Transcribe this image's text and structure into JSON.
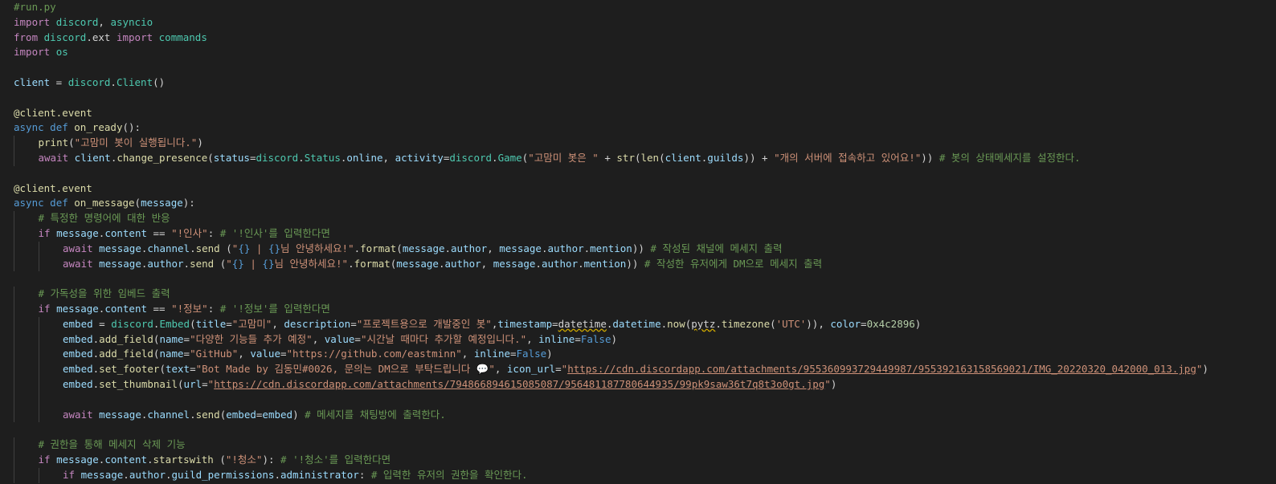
{
  "editor": {
    "lines": [
      {
        "indent": 0,
        "tokens": [
          [
            "com",
            "#run.py"
          ]
        ]
      },
      {
        "indent": 0,
        "tokens": [
          [
            "ctl",
            "import"
          ],
          [
            "p",
            " "
          ],
          [
            "cls",
            "discord"
          ],
          [
            "p",
            ", "
          ],
          [
            "cls",
            "asyncio"
          ]
        ]
      },
      {
        "indent": 0,
        "tokens": [
          [
            "ctl",
            "from"
          ],
          [
            "p",
            " "
          ],
          [
            "cls",
            "discord"
          ],
          [
            "p",
            ".ext "
          ],
          [
            "ctl",
            "import"
          ],
          [
            "p",
            " "
          ],
          [
            "cls",
            "commands"
          ]
        ]
      },
      {
        "indent": 0,
        "tokens": [
          [
            "ctl",
            "import"
          ],
          [
            "p",
            " "
          ],
          [
            "cls",
            "os"
          ]
        ]
      },
      {
        "indent": 0,
        "tokens": []
      },
      {
        "indent": 0,
        "tokens": [
          [
            "var",
            "client"
          ],
          [
            "p",
            " = "
          ],
          [
            "cls",
            "discord"
          ],
          [
            "p",
            "."
          ],
          [
            "cls",
            "Client"
          ],
          [
            "p",
            "()"
          ]
        ]
      },
      {
        "indent": 0,
        "tokens": []
      },
      {
        "indent": 0,
        "tokens": [
          [
            "dec",
            "@client.event"
          ]
        ]
      },
      {
        "indent": 0,
        "tokens": [
          [
            "kw",
            "async"
          ],
          [
            "p",
            " "
          ],
          [
            "kw",
            "def"
          ],
          [
            "p",
            " "
          ],
          [
            "fn",
            "on_ready"
          ],
          [
            "p",
            "():"
          ]
        ]
      },
      {
        "indent": 1,
        "tokens": [
          [
            "fn",
            "print"
          ],
          [
            "p",
            "("
          ],
          [
            "str",
            "\"고맘미 봇이 실행됩니다.\""
          ],
          [
            "p",
            ")"
          ]
        ]
      },
      {
        "indent": 1,
        "tokens": [
          [
            "ctl",
            "await"
          ],
          [
            "p",
            " "
          ],
          [
            "var",
            "client"
          ],
          [
            "p",
            "."
          ],
          [
            "fn",
            "change_presence"
          ],
          [
            "p",
            "("
          ],
          [
            "var",
            "status"
          ],
          [
            "p",
            "="
          ],
          [
            "cls",
            "discord"
          ],
          [
            "p",
            "."
          ],
          [
            "cls",
            "Status"
          ],
          [
            "p",
            "."
          ],
          [
            "var",
            "online"
          ],
          [
            "p",
            ", "
          ],
          [
            "var",
            "activity"
          ],
          [
            "p",
            "="
          ],
          [
            "cls",
            "discord"
          ],
          [
            "p",
            "."
          ],
          [
            "cls",
            "Game"
          ],
          [
            "p",
            "("
          ],
          [
            "str",
            "\"고맘미 봇은 \""
          ],
          [
            "p",
            " + "
          ],
          [
            "fn",
            "str"
          ],
          [
            "p",
            "("
          ],
          [
            "fn",
            "len"
          ],
          [
            "p",
            "("
          ],
          [
            "var",
            "client"
          ],
          [
            "p",
            "."
          ],
          [
            "var",
            "guilds"
          ],
          [
            "p",
            ")) + "
          ],
          [
            "str",
            "\"개의 서버에 접속하고 있어요!\""
          ],
          [
            "p",
            "))"
          ],
          [
            "com",
            " # 봇의 상태메세지를 설정한다."
          ]
        ]
      },
      {
        "indent": 0,
        "tokens": []
      },
      {
        "indent": 0,
        "tokens": [
          [
            "dec",
            "@client.event"
          ]
        ]
      },
      {
        "indent": 0,
        "tokens": [
          [
            "kw",
            "async"
          ],
          [
            "p",
            " "
          ],
          [
            "kw",
            "def"
          ],
          [
            "p",
            " "
          ],
          [
            "fn",
            "on_message"
          ],
          [
            "p",
            "("
          ],
          [
            "var",
            "message"
          ],
          [
            "p",
            "):"
          ]
        ]
      },
      {
        "indent": 1,
        "tokens": [
          [
            "com",
            "# 특정한 명령어에 대한 반응"
          ]
        ]
      },
      {
        "indent": 1,
        "tokens": [
          [
            "ctl",
            "if"
          ],
          [
            "p",
            " "
          ],
          [
            "var",
            "message"
          ],
          [
            "p",
            "."
          ],
          [
            "var",
            "content"
          ],
          [
            "p",
            " == "
          ],
          [
            "str",
            "\"!인사\""
          ],
          [
            "p",
            ": "
          ],
          [
            "com",
            "# '!인사'를 입력한다면"
          ]
        ]
      },
      {
        "indent": 2,
        "tokens": [
          [
            "ctl",
            "await"
          ],
          [
            "p",
            " "
          ],
          [
            "var",
            "message"
          ],
          [
            "p",
            "."
          ],
          [
            "var",
            "channel"
          ],
          [
            "p",
            "."
          ],
          [
            "fn",
            "send"
          ],
          [
            "p",
            " ("
          ],
          [
            "str",
            "\""
          ],
          [
            "esc",
            "{}"
          ],
          [
            "str",
            " | "
          ],
          [
            "esc",
            "{}"
          ],
          [
            "str",
            "님 안녕하세요!\""
          ],
          [
            "p",
            "."
          ],
          [
            "fn",
            "format"
          ],
          [
            "p",
            "("
          ],
          [
            "var",
            "message"
          ],
          [
            "p",
            "."
          ],
          [
            "var",
            "author"
          ],
          [
            "p",
            ", "
          ],
          [
            "var",
            "message"
          ],
          [
            "p",
            "."
          ],
          [
            "var",
            "author"
          ],
          [
            "p",
            "."
          ],
          [
            "var",
            "mention"
          ],
          [
            "p",
            "))"
          ],
          [
            "com",
            " # 작성된 채널에 메세지 출력"
          ]
        ]
      },
      {
        "indent": 2,
        "tokens": [
          [
            "ctl",
            "await"
          ],
          [
            "p",
            " "
          ],
          [
            "var",
            "message"
          ],
          [
            "p",
            "."
          ],
          [
            "var",
            "author"
          ],
          [
            "p",
            "."
          ],
          [
            "fn",
            "send"
          ],
          [
            "p",
            " ("
          ],
          [
            "str",
            "\""
          ],
          [
            "esc",
            "{}"
          ],
          [
            "str",
            " | "
          ],
          [
            "esc",
            "{}"
          ],
          [
            "str",
            "님 안녕하세요!\""
          ],
          [
            "p",
            "."
          ],
          [
            "fn",
            "format"
          ],
          [
            "p",
            "("
          ],
          [
            "var",
            "message"
          ],
          [
            "p",
            "."
          ],
          [
            "var",
            "author"
          ],
          [
            "p",
            ", "
          ],
          [
            "var",
            "message"
          ],
          [
            "p",
            "."
          ],
          [
            "var",
            "author"
          ],
          [
            "p",
            "."
          ],
          [
            "var",
            "mention"
          ],
          [
            "p",
            "))"
          ],
          [
            "com",
            " # 작성한 유저에게 DM으로 메세지 출력"
          ]
        ]
      },
      {
        "indent": 0,
        "tokens": []
      },
      {
        "indent": 1,
        "tokens": [
          [
            "com",
            "# 가독성을 위한 임베드 출력"
          ]
        ]
      },
      {
        "indent": 1,
        "tokens": [
          [
            "ctl",
            "if"
          ],
          [
            "p",
            " "
          ],
          [
            "var",
            "message"
          ],
          [
            "p",
            "."
          ],
          [
            "var",
            "content"
          ],
          [
            "p",
            " == "
          ],
          [
            "str",
            "\"!정보\""
          ],
          [
            "p",
            ": "
          ],
          [
            "com",
            "# '!정보'를 입력한다면"
          ]
        ]
      },
      {
        "indent": 2,
        "tokens": [
          [
            "var",
            "embed"
          ],
          [
            "p",
            " = "
          ],
          [
            "cls",
            "discord"
          ],
          [
            "p",
            "."
          ],
          [
            "cls",
            "Embed"
          ],
          [
            "p",
            "("
          ],
          [
            "var",
            "title"
          ],
          [
            "p",
            "="
          ],
          [
            "str",
            "\"고맘미\""
          ],
          [
            "p",
            ", "
          ],
          [
            "var",
            "description"
          ],
          [
            "p",
            "="
          ],
          [
            "str",
            "\"프로젝트용으로 개발중인 봇\""
          ],
          [
            "p",
            ","
          ],
          [
            "var",
            "timestamp"
          ],
          [
            "p",
            "="
          ],
          [
            "warn",
            "datetime"
          ],
          [
            "p",
            "."
          ],
          [
            "var",
            "datetime"
          ],
          [
            "p",
            "."
          ],
          [
            "fn",
            "now"
          ],
          [
            "p",
            "("
          ],
          [
            "warn",
            "pytz"
          ],
          [
            "p",
            "."
          ],
          [
            "fn",
            "timezone"
          ],
          [
            "p",
            "("
          ],
          [
            "str",
            "'UTC'"
          ],
          [
            "p",
            ")), "
          ],
          [
            "var",
            "color"
          ],
          [
            "p",
            "="
          ],
          [
            "num",
            "0x4c2896"
          ],
          [
            "p",
            ")"
          ]
        ]
      },
      {
        "indent": 2,
        "tokens": [
          [
            "var",
            "embed"
          ],
          [
            "p",
            "."
          ],
          [
            "fn",
            "add_field"
          ],
          [
            "p",
            "("
          ],
          [
            "var",
            "name"
          ],
          [
            "p",
            "="
          ],
          [
            "str",
            "\"다양한 기능들 추가 예정\""
          ],
          [
            "p",
            ", "
          ],
          [
            "var",
            "value"
          ],
          [
            "p",
            "="
          ],
          [
            "str",
            "\"시간날 때마다 추가할 예정입니다.\""
          ],
          [
            "p",
            ", "
          ],
          [
            "var",
            "inline"
          ],
          [
            "p",
            "="
          ],
          [
            "bool",
            "False"
          ],
          [
            "p",
            ")"
          ]
        ]
      },
      {
        "indent": 2,
        "tokens": [
          [
            "var",
            "embed"
          ],
          [
            "p",
            "."
          ],
          [
            "fn",
            "add_field"
          ],
          [
            "p",
            "("
          ],
          [
            "var",
            "name"
          ],
          [
            "p",
            "="
          ],
          [
            "str",
            "\"GitHub\""
          ],
          [
            "p",
            ", "
          ],
          [
            "var",
            "value"
          ],
          [
            "p",
            "="
          ],
          [
            "str",
            "\"https://github.com/eastminn\""
          ],
          [
            "p",
            ", "
          ],
          [
            "var",
            "inline"
          ],
          [
            "p",
            "="
          ],
          [
            "bool",
            "False"
          ],
          [
            "p",
            ")"
          ]
        ]
      },
      {
        "indent": 2,
        "tokens": [
          [
            "var",
            "embed"
          ],
          [
            "p",
            "."
          ],
          [
            "fn",
            "set_footer"
          ],
          [
            "p",
            "("
          ],
          [
            "var",
            "text"
          ],
          [
            "p",
            "="
          ],
          [
            "str",
            "\"Bot Made by 김동민#0026, 문의는 DM으로 부탁드립니다 💬\""
          ],
          [
            "p",
            ", "
          ],
          [
            "var",
            "icon_url"
          ],
          [
            "p",
            "="
          ],
          [
            "str",
            "\""
          ],
          [
            "url",
            "https://cdn.discordapp.com/attachments/955360993729449987/955392163158569021/IMG_20220320_042000_013.jpg"
          ],
          [
            "str",
            "\""
          ],
          [
            "p",
            ")"
          ]
        ]
      },
      {
        "indent": 2,
        "tokens": [
          [
            "var",
            "embed"
          ],
          [
            "p",
            "."
          ],
          [
            "fn",
            "set_thumbnail"
          ],
          [
            "p",
            "("
          ],
          [
            "var",
            "url"
          ],
          [
            "p",
            "="
          ],
          [
            "str",
            "\""
          ],
          [
            "url",
            "https://cdn.discordapp.com/attachments/794866894615085087/956481187780644935/99pk9saw36t7q8t3o0gt.jpg"
          ],
          [
            "str",
            "\""
          ],
          [
            "p",
            ")"
          ]
        ]
      },
      {
        "indent": 2,
        "tokens": []
      },
      {
        "indent": 2,
        "tokens": [
          [
            "ctl",
            "await"
          ],
          [
            "p",
            " "
          ],
          [
            "var",
            "message"
          ],
          [
            "p",
            "."
          ],
          [
            "var",
            "channel"
          ],
          [
            "p",
            "."
          ],
          [
            "fn",
            "send"
          ],
          [
            "p",
            "("
          ],
          [
            "var",
            "embed"
          ],
          [
            "p",
            "="
          ],
          [
            "var",
            "embed"
          ],
          [
            "p",
            ")"
          ],
          [
            "com",
            " # 메세지를 채팅방에 출력한다."
          ]
        ]
      },
      {
        "indent": 0,
        "tokens": []
      },
      {
        "indent": 1,
        "tokens": [
          [
            "com",
            "# 권한을 통해 메세지 삭제 기능"
          ]
        ]
      },
      {
        "indent": 1,
        "tokens": [
          [
            "ctl",
            "if"
          ],
          [
            "p",
            " "
          ],
          [
            "var",
            "message"
          ],
          [
            "p",
            "."
          ],
          [
            "var",
            "content"
          ],
          [
            "p",
            "."
          ],
          [
            "fn",
            "startswith"
          ],
          [
            "p",
            " ("
          ],
          [
            "str",
            "\"!청소\""
          ],
          [
            "p",
            "): "
          ],
          [
            "com",
            "# '!청소'를 입력한다면"
          ]
        ]
      },
      {
        "indent": 2,
        "tokens": [
          [
            "ctl",
            "if"
          ],
          [
            "p",
            " "
          ],
          [
            "var",
            "message"
          ],
          [
            "p",
            "."
          ],
          [
            "var",
            "author"
          ],
          [
            "p",
            "."
          ],
          [
            "var",
            "guild_permissions"
          ],
          [
            "p",
            "."
          ],
          [
            "var",
            "administrator"
          ],
          [
            "p",
            ": "
          ],
          [
            "com",
            "# 입력한 유저의 권한을 확인한다."
          ]
        ]
      }
    ]
  }
}
